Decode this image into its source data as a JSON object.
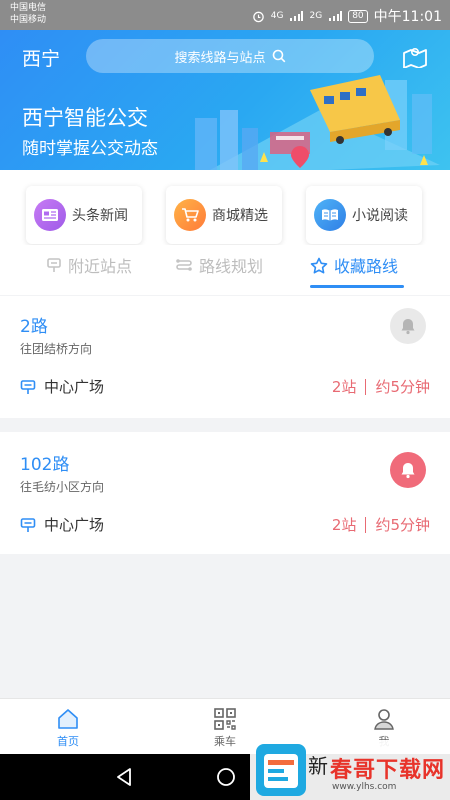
{
  "status": {
    "carrier1": "中国电信",
    "carrier2": "中国移动",
    "battery": "80",
    "time": "中午11:01",
    "network1": "4G",
    "network2": "2G"
  },
  "header": {
    "city": "西宁",
    "search_placeholder": "搜索线路与站点",
    "slogan_line1": "西宁智能公交",
    "slogan_line2": "随时掌握公交动态"
  },
  "shortcuts": [
    {
      "label": "头条新闻",
      "icon": "news-icon"
    },
    {
      "label": "商城精选",
      "icon": "cart-icon"
    },
    {
      "label": "小说阅读",
      "icon": "book-icon"
    }
  ],
  "tabs": [
    {
      "label": "附近站点",
      "icon": "bus-stop-icon",
      "active": false
    },
    {
      "label": "路线规划",
      "icon": "route-icon",
      "active": false
    },
    {
      "label": "收藏路线",
      "icon": "star-icon",
      "active": true
    }
  ],
  "routes": [
    {
      "name": "2路",
      "direction": "往团结桥方向",
      "station": "中心广场",
      "stops": "2站",
      "eta": "约5分钟",
      "alert": false
    },
    {
      "name": "102路",
      "direction": "往毛纺小区方向",
      "station": "中心广场",
      "stops": "2站",
      "eta": "约5分钟",
      "alert": true
    }
  ],
  "bottom_nav": [
    {
      "label": "首页",
      "icon": "home-icon",
      "active": true
    },
    {
      "label": "乘车",
      "icon": "qrcode-icon",
      "active": false
    },
    {
      "label": "我",
      "icon": "profile-icon",
      "active": false
    }
  ],
  "watermark": {
    "text": "春哥下载网",
    "sub": "www.ylhs.com",
    "partial": "新"
  },
  "colors": {
    "accent": "#2f8ef5",
    "alert": "#f06b7a",
    "eta": "#e86a73"
  }
}
